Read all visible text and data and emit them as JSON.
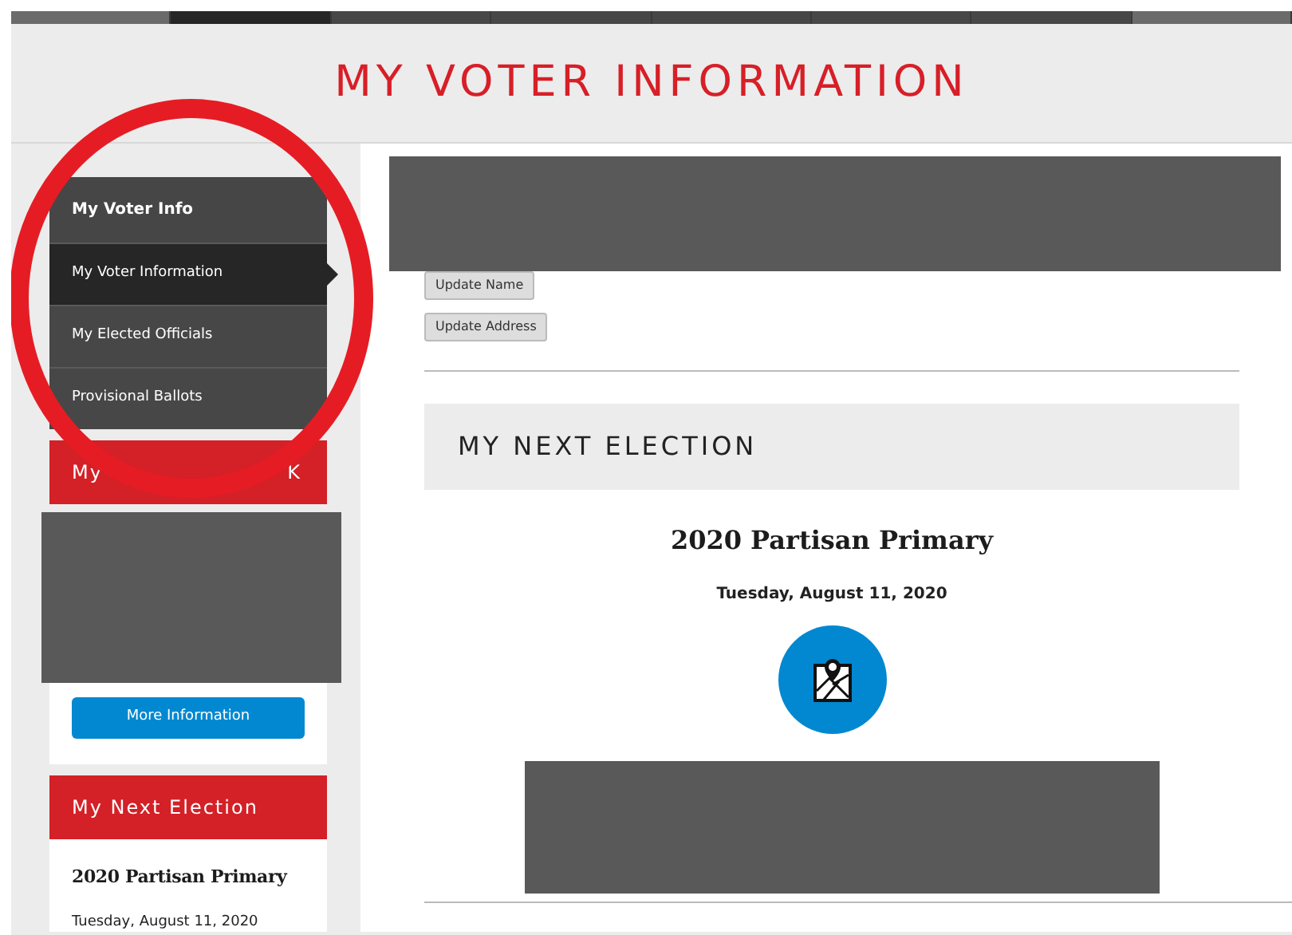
{
  "top_nav": [
    {
      "kind": "edge",
      "selected": false
    },
    {
      "kind": "tab",
      "selected": true
    },
    {
      "kind": "tab",
      "selected": false
    },
    {
      "kind": "tab",
      "selected": false
    },
    {
      "kind": "tab",
      "selected": false
    },
    {
      "kind": "tab",
      "selected": false
    },
    {
      "kind": "tab",
      "selected": false
    },
    {
      "kind": "edge",
      "selected": false
    }
  ],
  "page_title": "MY VOTER INFORMATION",
  "annotation": {
    "kind": "circle",
    "color": "#e61c24"
  },
  "sidebar": {
    "menu_title": "My Voter Info",
    "items": [
      {
        "label": "My Voter Information",
        "selected": true
      },
      {
        "label": "My Elected Officials",
        "selected": false
      },
      {
        "label": "Provisional Ballots",
        "selected": false
      }
    ],
    "card_header": {
      "left": "My",
      "right": "K"
    },
    "card_redacted": true,
    "card_button": "More Information",
    "election_header": "My Next Election",
    "election_name": "2020 Partisan Primary",
    "election_date": "Tuesday, August 11, 2020"
  },
  "main": {
    "header_redacted": true,
    "buttons": [
      "Update Name",
      "Update Address"
    ],
    "section_title": "MY NEXT ELECTION",
    "election_name": "2020 Partisan Primary",
    "election_date": "Tuesday, August 11, 2020",
    "details_redacted": true
  }
}
